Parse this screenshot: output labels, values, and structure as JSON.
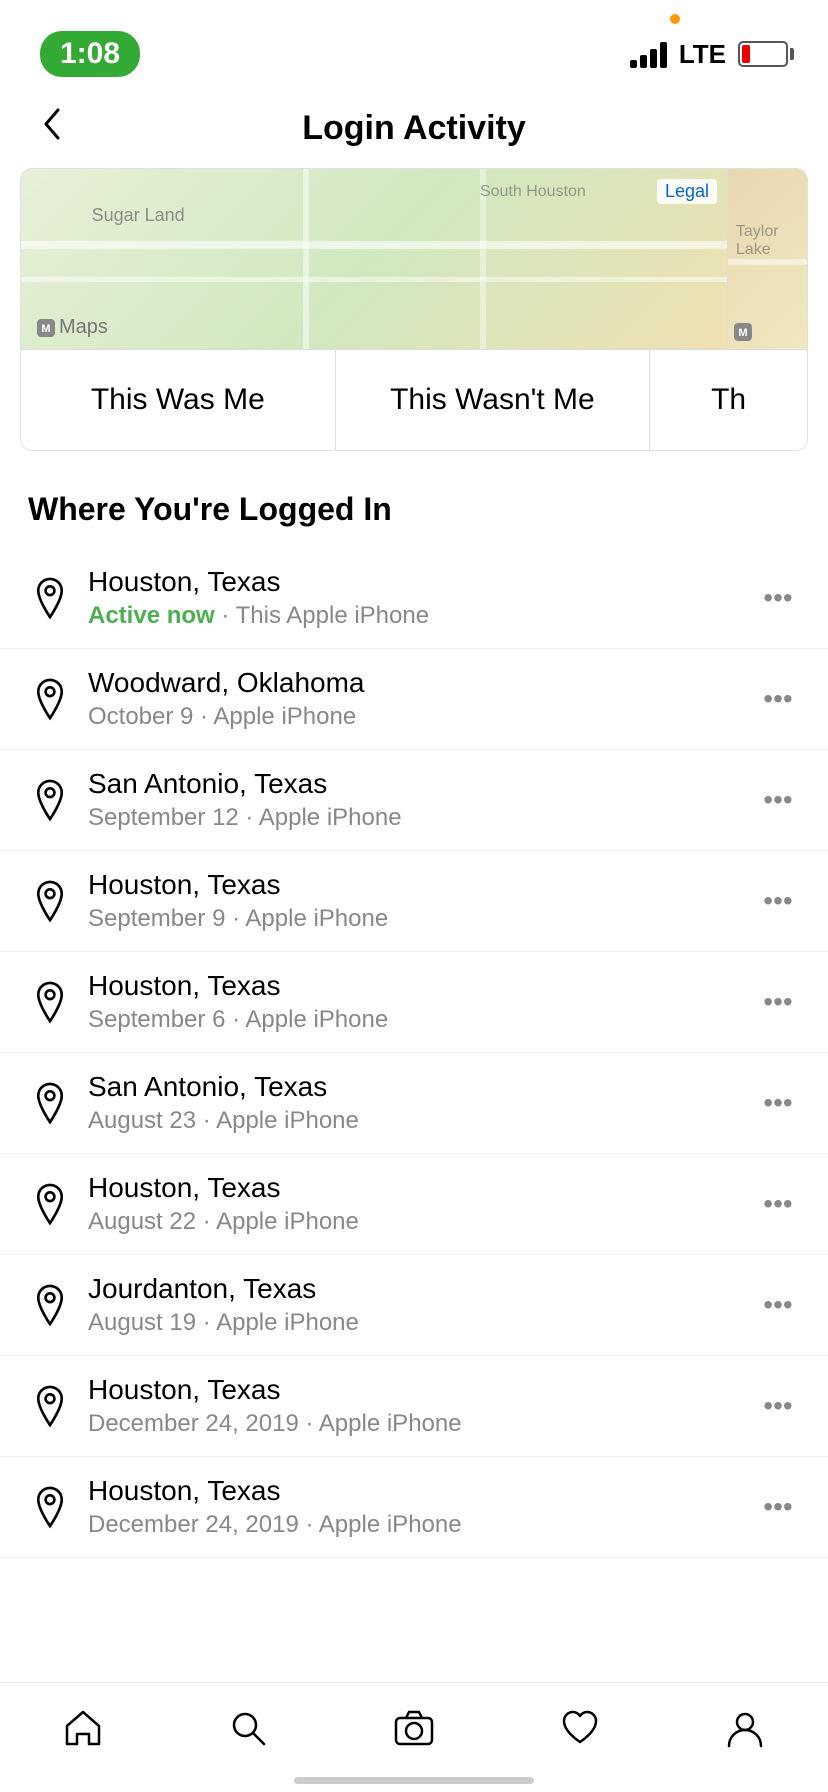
{
  "statusBar": {
    "time": "1:08",
    "lte": "LTE"
  },
  "header": {
    "backLabel": "‹",
    "title": "Login Activity"
  },
  "mapLabels": {
    "appleMapsBadge1": "Maps",
    "appleMapsBadge2": "Maps",
    "sugarLand": "Sugar Land",
    "legal": "Legal"
  },
  "actionButtons": {
    "thisWasMe": "This Was Me",
    "thisWasntMe": "This Wasn't Me",
    "partial": "Th"
  },
  "sectionTitle": "Where You're Logged In",
  "loginItems": [
    {
      "city": "Houston, Texas",
      "activeNow": "Active now",
      "meta": " · This Apple iPhone",
      "isActive": true
    },
    {
      "city": "Woodward, Oklahoma",
      "activeNow": "",
      "meta": "October 9 · Apple iPhone",
      "isActive": false
    },
    {
      "city": "San Antonio, Texas",
      "activeNow": "",
      "meta": "September 12 · Apple iPhone",
      "isActive": false
    },
    {
      "city": "Houston, Texas",
      "activeNow": "",
      "meta": "September 9 · Apple iPhone",
      "isActive": false
    },
    {
      "city": "Houston, Texas",
      "activeNow": "",
      "meta": "September 6 · Apple iPhone",
      "isActive": false
    },
    {
      "city": "San Antonio, Texas",
      "activeNow": "",
      "meta": "August 23 · Apple iPhone",
      "isActive": false
    },
    {
      "city": "Houston, Texas",
      "activeNow": "",
      "meta": "August 22 · Apple iPhone",
      "isActive": false
    },
    {
      "city": "Jourdanton, Texas",
      "activeNow": "",
      "meta": "August 19 · Apple iPhone",
      "isActive": false
    },
    {
      "city": "Houston, Texas",
      "activeNow": "",
      "meta": "December 24, 2019 · Apple iPhone",
      "isActive": false
    },
    {
      "city": "Houston, Texas",
      "activeNow": "",
      "meta": "December 24, 2019 · Apple iPhone",
      "isActive": false
    }
  ],
  "bottomNav": {
    "home": "home",
    "search": "search",
    "camera": "camera",
    "activity": "activity",
    "profile": "profile"
  }
}
